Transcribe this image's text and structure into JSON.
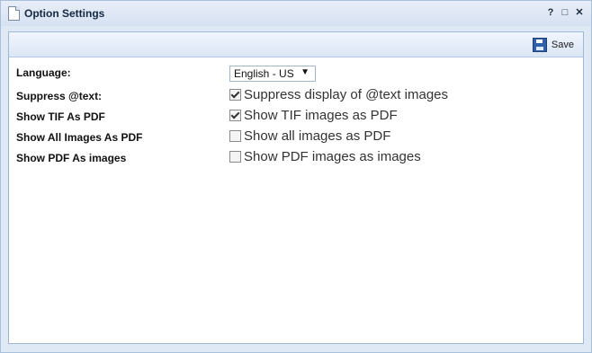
{
  "window": {
    "title": "Option Settings",
    "help_label": "?",
    "maximize_label": "□",
    "close_label": "✕"
  },
  "toolbar": {
    "save_label": "Save"
  },
  "settings": [
    {
      "label": "Language:",
      "type": "select",
      "value": "English - US"
    },
    {
      "label": "Suppress @text:",
      "type": "checkbox",
      "checked": true,
      "text": "Suppress display of @text images"
    },
    {
      "label": "Show TIF As PDF",
      "type": "checkbox",
      "checked": true,
      "text": "Show TIF images as PDF"
    },
    {
      "label": "Show All Images As PDF",
      "type": "checkbox",
      "checked": false,
      "text": "Show all images as PDF"
    },
    {
      "label": "Show PDF As images",
      "type": "checkbox",
      "checked": false,
      "text": "Show PDF images as images"
    }
  ],
  "icons": [
    "document-icon",
    "help-icon",
    "maximize-icon",
    "close-icon",
    "save-disk-icon",
    "dropdown-caret-icon"
  ]
}
